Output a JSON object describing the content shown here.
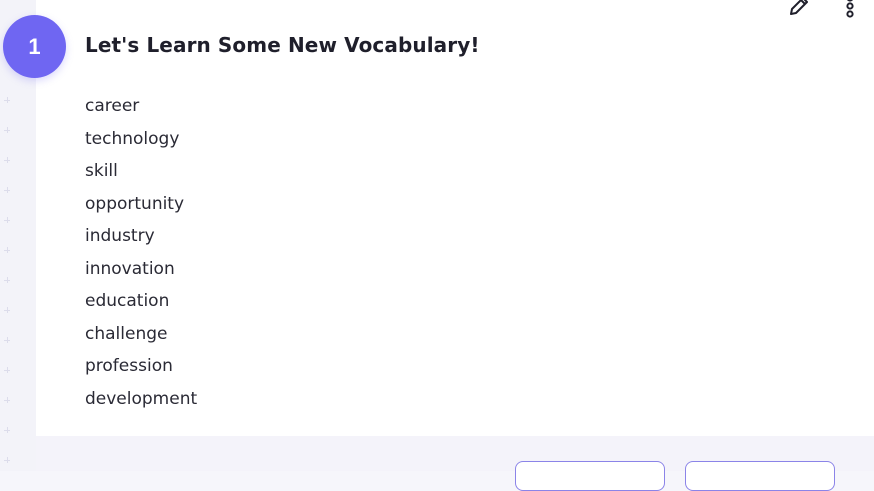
{
  "step": {
    "number": "1"
  },
  "section": {
    "title": "Let's Learn Some New Vocabulary!"
  },
  "vocabulary": [
    "career",
    "technology",
    "skill",
    "opportunity",
    "industry",
    "innovation",
    "education",
    "challenge",
    "profession",
    "development"
  ],
  "toolbar": {
    "edit_icon": "pencil-icon",
    "more_icon": "more-vertical-icon"
  },
  "colors": {
    "accent": "#6f66f2",
    "text": "#1f1f2b",
    "footer_bg": "#f4f3fa",
    "button_border": "#8b84e8"
  }
}
